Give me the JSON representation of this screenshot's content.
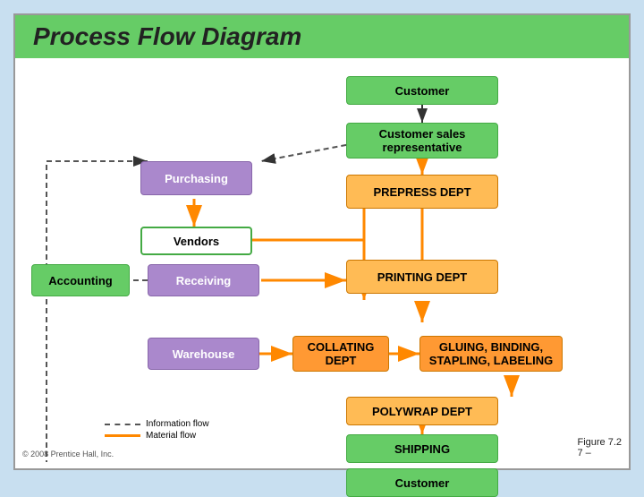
{
  "title": "Process Flow Diagram",
  "boxes": {
    "customer_top": "Customer",
    "customer_sales": "Customer sales representative",
    "purchasing": "Purchasing",
    "vendors": "Vendors",
    "accounting": "Accounting",
    "receiving": "Receiving",
    "warehouse": "Warehouse",
    "prepress": "PREPRESS DEPT",
    "printing": "PRINTING DEPT",
    "collating": "COLLATING DEPT",
    "gluing": "GLUING, BINDING, STAPLING, LABELING",
    "polywrap": "POLYWRAP DEPT",
    "shipping": "SHIPPING",
    "customer_bottom": "Customer"
  },
  "legend": {
    "info_flow": "Information flow",
    "material_flow": "Material flow"
  },
  "footer": "© 2008 Prentice Hall, Inc.",
  "figure": "Figure 7.2",
  "page": "7 –"
}
